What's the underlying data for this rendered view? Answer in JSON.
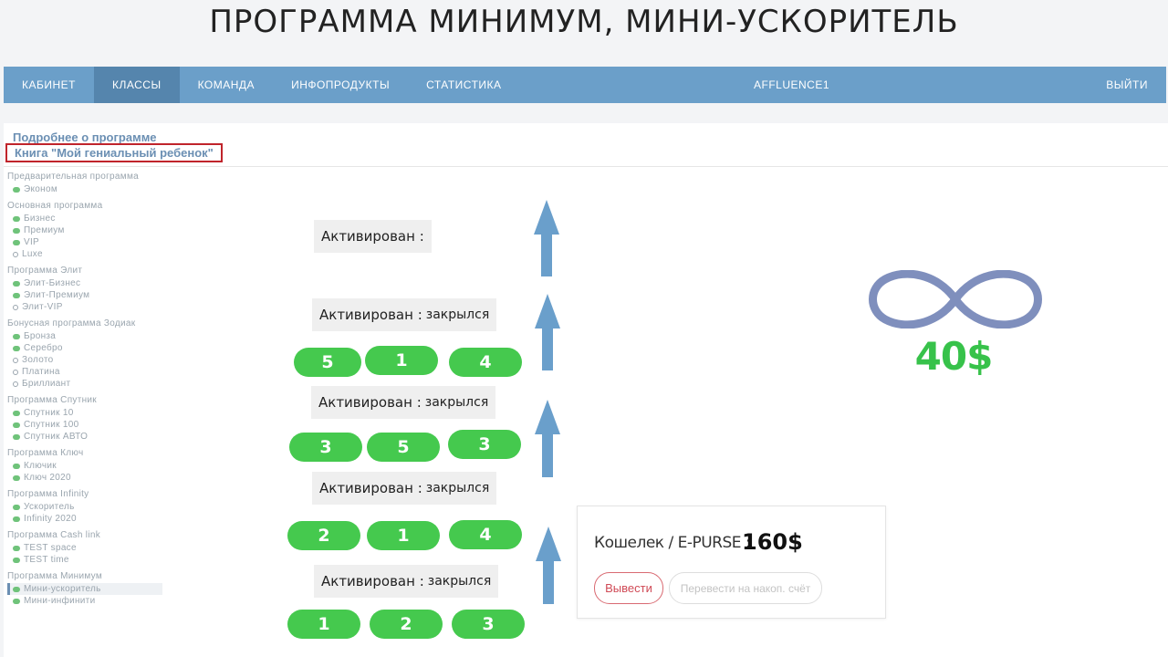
{
  "page_title": "ПРОГРАММА МИНИМУМ, МИНИ-УСКОРИТЕЛЬ",
  "nav": {
    "items": [
      "КАБИНЕТ",
      "КЛАССЫ",
      "КОМАНДА",
      "ИНФОПРОДУКТЫ",
      "СТАТИСТИКА"
    ],
    "user": "AFFLUENCE1",
    "logout": "ВЫЙТИ"
  },
  "links": {
    "about": "Подробнее о программе",
    "book": "Книга \"Мой гениальный ребенок\""
  },
  "sidebar": [
    {
      "title": "Предварительная программа",
      "items": [
        {
          "label": "Эконом",
          "active": true
        }
      ]
    },
    {
      "title": "Основная программа",
      "items": [
        {
          "label": "Бизнес",
          "active": true
        },
        {
          "label": "Премиум",
          "active": true
        },
        {
          "label": "VIP",
          "active": true
        },
        {
          "label": "Luxe",
          "active": false
        }
      ]
    },
    {
      "title": "Программа Элит",
      "items": [
        {
          "label": "Элит-Бизнес",
          "active": true
        },
        {
          "label": "Элит-Премиум",
          "active": true
        },
        {
          "label": "Элит-VIP",
          "active": false
        }
      ]
    },
    {
      "title": "Бонусная программа Зодиак",
      "items": [
        {
          "label": "Бронза",
          "active": true
        },
        {
          "label": "Серебро",
          "active": true
        },
        {
          "label": "Золото",
          "active": false
        },
        {
          "label": "Платина",
          "active": false
        },
        {
          "label": "Бриллиант",
          "active": false
        }
      ]
    },
    {
      "title": "Программа Спутник",
      "items": [
        {
          "label": "Спутник 10",
          "active": true
        },
        {
          "label": "Спутник 100",
          "active": true
        },
        {
          "label": "Спутник АВТО",
          "active": true
        }
      ]
    },
    {
      "title": "Программа Ключ",
      "items": [
        {
          "label": "Ключик",
          "active": true
        },
        {
          "label": "Ключ 2020",
          "active": true
        }
      ]
    },
    {
      "title": "Программа Infinity",
      "items": [
        {
          "label": "Ускоритель",
          "active": true
        },
        {
          "label": "Infinity 2020",
          "active": true
        }
      ]
    },
    {
      "title": "Программа Cash link",
      "items": [
        {
          "label": "TEST space",
          "active": true
        },
        {
          "label": "TEST time",
          "active": true
        }
      ]
    },
    {
      "title": "Программа Минимум",
      "items": [
        {
          "label": "Мини-ускоритель",
          "active": true,
          "selected": true
        },
        {
          "label": "Мини-инфинити",
          "active": true
        }
      ]
    }
  ],
  "levels": [
    {
      "activated_label": "Активирован :",
      "status": "",
      "pills": []
    },
    {
      "activated_label": "Активирован :",
      "status": "закрылся",
      "pills": [
        "5",
        "1",
        "4"
      ]
    },
    {
      "activated_label": "Активирован :",
      "status": "закрылся",
      "pills": [
        "3",
        "5",
        "3"
      ]
    },
    {
      "activated_label": "Активирован :",
      "status": "закрылся",
      "pills": [
        "2",
        "1",
        "4"
      ]
    },
    {
      "activated_label": "Активирован :",
      "status": "закрылся",
      "pills": [
        "1",
        "2",
        "3"
      ]
    }
  ],
  "infinity": {
    "amount": "40$",
    "icon": "infinity-icon"
  },
  "wallet": {
    "label": "Кошелек / E-PURSE :",
    "amount": "160$",
    "withdraw": "Вывести",
    "transfer": "Перевести на накоп. счёт"
  },
  "colors": {
    "nav": "#6b9fc9",
    "pill": "#45c94e",
    "arrow": "#6a9fcb",
    "amount_green": "#37c24a",
    "infinity": "#7f8fbd"
  }
}
